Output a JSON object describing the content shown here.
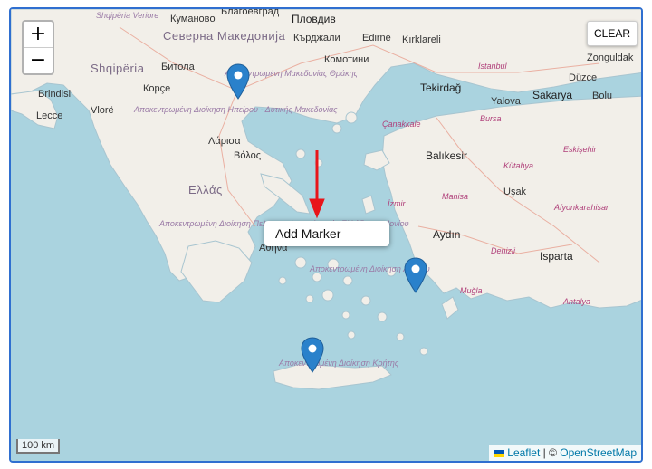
{
  "controls": {
    "zoom_in": "+",
    "zoom_out": "−",
    "clear": "CLEAR"
  },
  "context_menu": {
    "add_marker": "Add Marker"
  },
  "scale": "100 km",
  "attribution": {
    "leaflet": "Leaflet",
    "sep": " | © ",
    "osm": "OpenStreetMap"
  },
  "labels": {
    "cities": [
      "Кумановo",
      "Благоевград",
      "Пловдив",
      "Кърджали",
      "Edirne",
      "Kırklareli",
      "Комотини",
      "Битола",
      "Корçе",
      "Brindisi",
      "Lecce",
      "Vlorë",
      "Λάρισα",
      "Βόλος",
      "Αθήνα",
      "Tekirdağ",
      "Yalova",
      "Sakarya",
      "Düzce",
      "Bolu",
      "Zonguldak",
      "Balıkesir",
      "Uşak",
      "Aydın",
      "Isparta",
      "İzmir",
      "Çanakkale",
      "Bursa",
      "Kütahya",
      "Eskişehir",
      "Afyonkarahisar",
      "Manisa",
      "Denizli",
      "Muğla",
      "Antalya",
      "İstanbul"
    ],
    "countries": [
      "Shqipëria",
      "Северна Македонија",
      "Ελλάς"
    ],
    "admin": [
      "Shqipëria Veriore",
      "Αποκεντρωμένη Διοίκηση Ηπείρου - Δυτικής Μακεδονίας",
      "Αποκεντρωμένη Διοίκηση Πελοποννήσου, Δυτικής Ελλάδας και Ιονίου",
      "Αποκεντρωμένη Διοίκηση Αιγαίου",
      "Αποκεντρωμένη Διοίκηση Κρήτης",
      "Αποκεντρωμένη Μακεδονίας Θράκης"
    ]
  },
  "markers": [
    {
      "label": "marker-thessaloniki",
      "color": "#2a81cb"
    },
    {
      "label": "marker-bodrum",
      "color": "#2a81cb"
    },
    {
      "label": "marker-crete",
      "color": "#2a81cb"
    }
  ],
  "colors": {
    "water": "#aad3df",
    "land": "#f2efe9",
    "border": "#2f6fd0",
    "arrow": "#e8141a"
  }
}
